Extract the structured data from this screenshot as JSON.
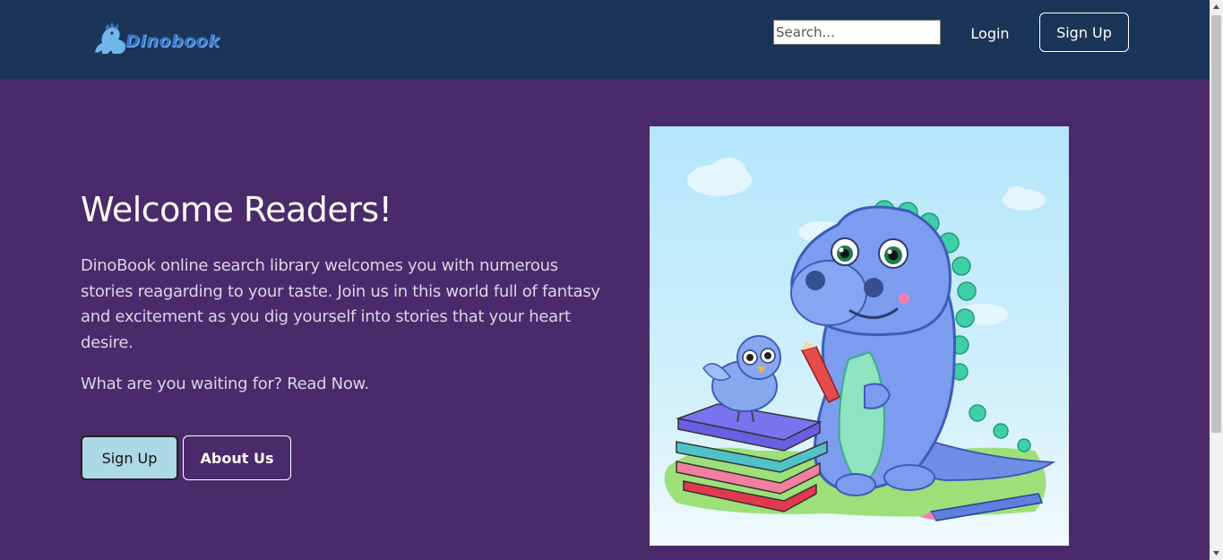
{
  "brand": {
    "name": "Dinobook",
    "colors": {
      "header_bg": "#1a3558",
      "page_bg": "#4a2a6b",
      "accent": "#add8e6"
    }
  },
  "nav": {
    "search_placeholder": "Search...",
    "login_label": "Login",
    "signup_label": "Sign Up"
  },
  "hero": {
    "title": "Welcome Readers!",
    "body": "DinoBook online search library welcomes you with numerous stories reagarding to your taste. Join us in this world full of fantasy and excitement as you dig yourself into stories that your heart desire.",
    "cta_text": "What are you waiting for? Read Now.",
    "signup_label": "Sign Up",
    "about_label": "About Us",
    "image_icon": "dinosaur-reading-illustration"
  }
}
